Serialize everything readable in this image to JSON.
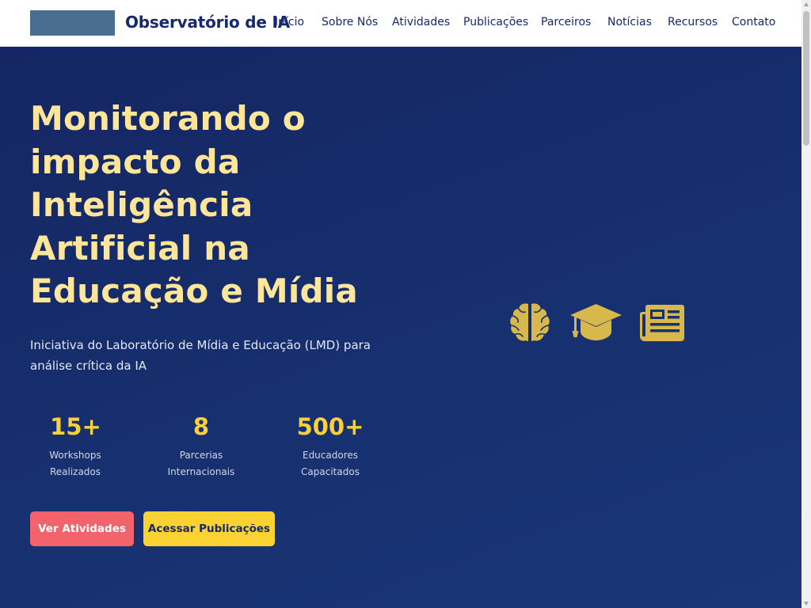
{
  "header": {
    "site_title": "Observatório de IA",
    "nav": [
      "Início",
      "Sobre Nós",
      "Atividades",
      "Publicações",
      "Parceiros",
      "Notícias",
      "Recursos",
      "Contato"
    ]
  },
  "hero": {
    "title": "Monitorando o impacto da Inteligência Artificial na Educação e Mídia",
    "subtitle": "Iniciativa do Laboratório de Mídia e Educação (LMD) para análise crítica da IA",
    "stats": [
      {
        "value": "15+",
        "label": "Workshops Realizados"
      },
      {
        "value": "8",
        "label": "Parcerias Internacionais"
      },
      {
        "value": "500+",
        "label": "Educadores Capacitados"
      }
    ],
    "buttons": {
      "primary": "Ver Atividades",
      "secondary": "Acessar Publicações"
    },
    "icons": [
      "brain-icon",
      "graduation-cap-icon",
      "newspaper-icon"
    ]
  },
  "colors": {
    "header_bg": "#ffffff",
    "brand_navy": "#16296b",
    "hero_bg": "#152663",
    "title_yellow": "#fde69a",
    "accent_yellow": "#f8cf3d",
    "button_red": "#f2636c",
    "button_yellow": "#fad232",
    "icon_gold": "#d8b84a"
  }
}
